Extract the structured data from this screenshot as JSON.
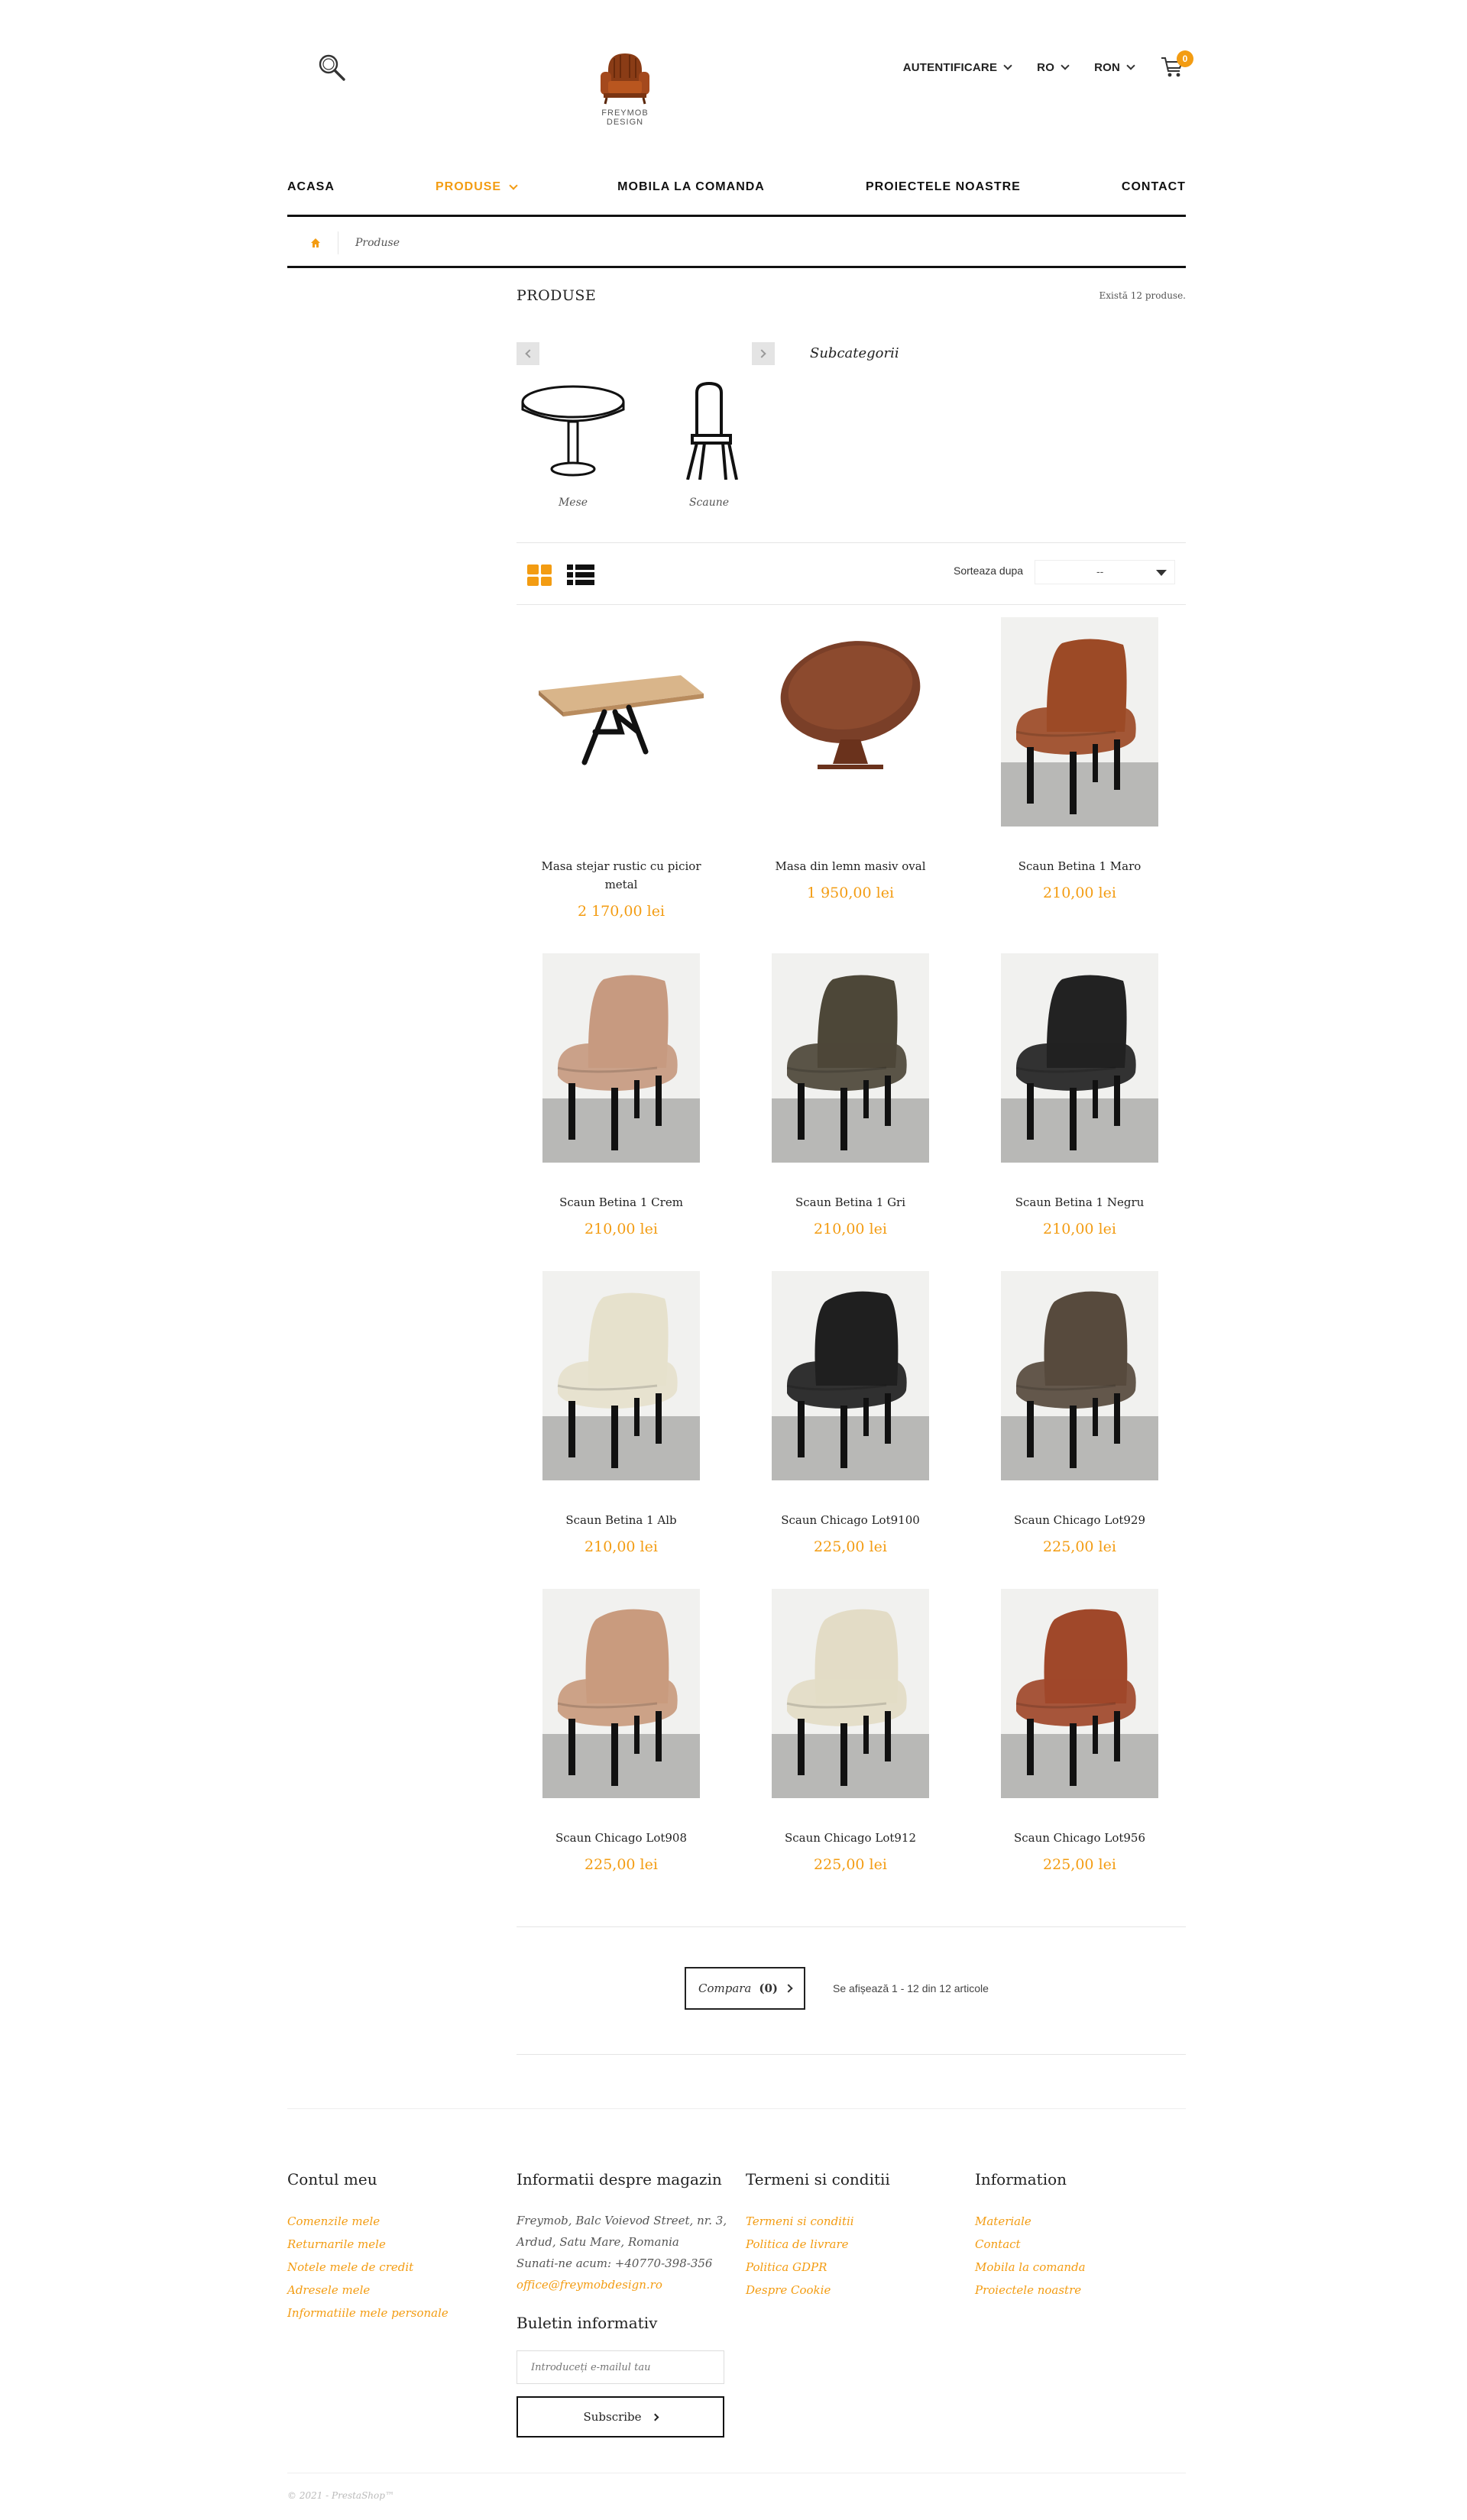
{
  "header": {
    "logo_text_1": "FREYMOB",
    "logo_text_2": "DESIGN",
    "login": "AUTENTIFICARE",
    "language": "RO",
    "currency": "RON",
    "cart_count": "0"
  },
  "nav": {
    "items": [
      {
        "label": "ACASA"
      },
      {
        "label": "PRODUSE"
      },
      {
        "label": "MOBILA LA COMANDA"
      },
      {
        "label": "PROIECTELE NOASTRE"
      },
      {
        "label": "CONTACT"
      }
    ]
  },
  "breadcrumb": {
    "current": "Produse"
  },
  "main": {
    "title": "PRODUSE",
    "count": "Există 12 produse.",
    "subcategories_title": "Subcategorii",
    "subcategories": [
      {
        "label": "Mese"
      },
      {
        "label": "Scaune"
      }
    ],
    "sort_label": "Sorteaza dupa",
    "sort_value": "--"
  },
  "products": [
    {
      "name": "Masa stejar rustic cu picior metal",
      "price": "2 170,00 lei",
      "color": "#d9b58a"
    },
    {
      "name": "Masa din lemn masiv oval",
      "price": "1 950,00 lei",
      "color": "#7a3f28"
    },
    {
      "name": "Scaun Betina 1 Maro",
      "price": "210,00 lei",
      "color": "#9c4a26"
    },
    {
      "name": "Scaun Betina 1 Crem",
      "price": "210,00 lei",
      "color": "#c79a80"
    },
    {
      "name": "Scaun Betina 1 Gri",
      "price": "210,00 lei",
      "color": "#4d4738"
    },
    {
      "name": "Scaun Betina 1 Negru",
      "price": "210,00 lei",
      "color": "#222222"
    },
    {
      "name": "Scaun Betina 1 Alb",
      "price": "210,00 lei",
      "color": "#e6e1cc"
    },
    {
      "name": "Scaun Chicago Lot9100",
      "price": "225,00 lei",
      "color": "#1f1f1f"
    },
    {
      "name": "Scaun Chicago Lot929",
      "price": "225,00 lei",
      "color": "#574a3d"
    },
    {
      "name": "Scaun Chicago Lot908",
      "price": "225,00 lei",
      "color": "#c99b7e"
    },
    {
      "name": "Scaun Chicago Lot912",
      "price": "225,00 lei",
      "color": "#e3dcc6"
    },
    {
      "name": "Scaun Chicago Lot956",
      "price": "225,00 lei",
      "color": "#a0482a"
    }
  ],
  "pager": {
    "compare_label": "Compara",
    "compare_count": "(0)",
    "showing": "Se afișează 1 - 12 din 12 articole"
  },
  "footer": {
    "account": {
      "title": "Contul meu",
      "links": [
        "Comenzile mele",
        "Returnarile mele",
        "Notele mele de credit",
        "Adresele mele",
        "Informatiile mele personale"
      ]
    },
    "store": {
      "title": "Informatii despre magazin",
      "address_1": "Freymob, Balc Voievod Street, nr. 3,",
      "address_2": "Ardud, Satu Mare, Romania",
      "phone": "Sunati-ne acum: +40770-398-356",
      "email": "office@freymobdesign.ro"
    },
    "terms": {
      "title": "Termeni si conditii",
      "links": [
        "Termeni si conditii",
        "Politica de livrare",
        "Politica GDPR",
        "Despre Cookie"
      ]
    },
    "info": {
      "title": "Information",
      "links": [
        "Materiale",
        "Contact",
        "Mobila la comanda",
        "Proiectele noastre"
      ]
    },
    "newsletter": {
      "title": "Buletin informativ",
      "placeholder": "Introduceți e-mailul tau",
      "button": "Subscribe"
    },
    "copyright": "© 2021 - PrestaShop™"
  },
  "colors": {
    "accent": "#f39c12"
  }
}
